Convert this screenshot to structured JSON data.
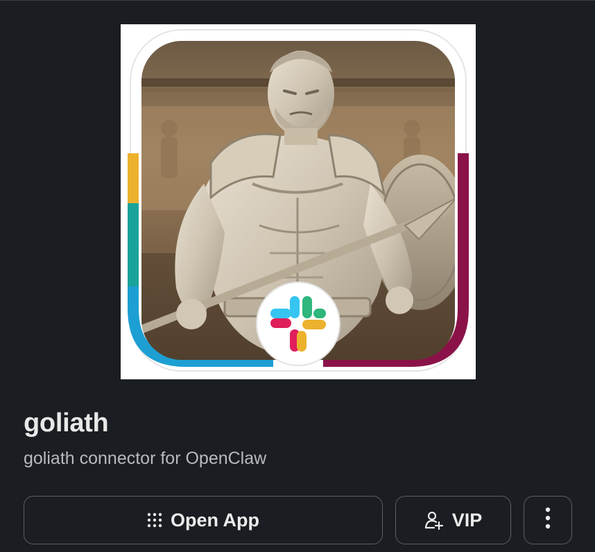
{
  "app": {
    "name": "goliath",
    "description": "goliath connector for OpenClaw"
  },
  "avatar": {
    "icon": "gladiator-statue-avatar",
    "badge_icon": "slack-logo-icon"
  },
  "actions": {
    "open_app_label": "Open App",
    "open_app_icon": "grid-dots-icon",
    "vip_label": "VIP",
    "vip_icon": "add-person-icon",
    "more_icon": "vertical-ellipsis-icon"
  },
  "colors": {
    "background": "#1a1d21",
    "button_border": "#5c5f64",
    "text_primary": "#e8e8e8",
    "text_secondary": "#b9babd",
    "slack_yellow": "#ecb22e",
    "slack_green": "#2eb67d",
    "slack_blue": "#36c5f0",
    "slack_red": "#e01e5a",
    "ring_teal": "#1aa39a",
    "ring_blue": "#1d9fd3",
    "ring_maroon": "#8a1249"
  }
}
